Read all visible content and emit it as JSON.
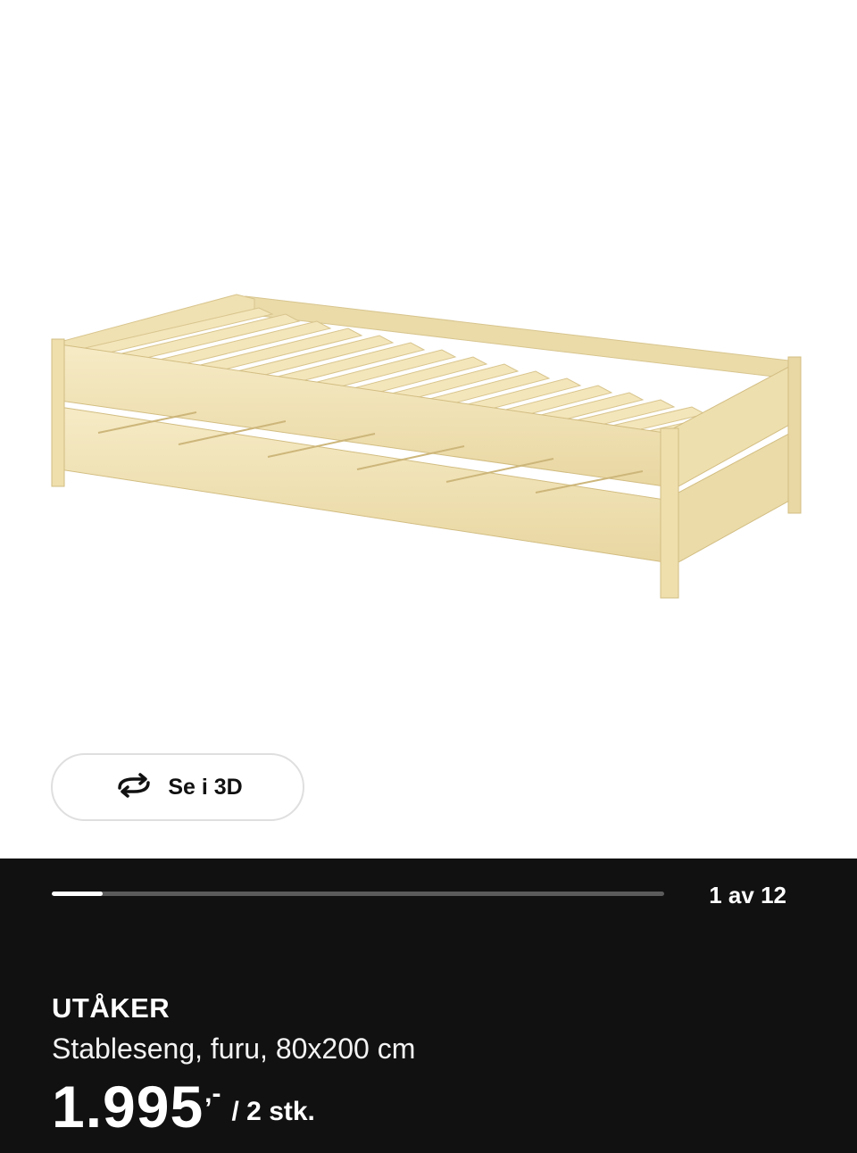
{
  "view3d": {
    "label": "Se i 3D",
    "icon": "rotate-3d-icon"
  },
  "gallery": {
    "counter": "1 av 12",
    "progress": 0.083
  },
  "product": {
    "name": "UTÅKER",
    "description": "Stableseng, furu, 80x200 cm",
    "price": "1.995",
    "price_suffix": ",-",
    "unit": "/ 2 stk."
  },
  "colors": {
    "panel": "#111111",
    "wood": "#f1e2b3"
  }
}
